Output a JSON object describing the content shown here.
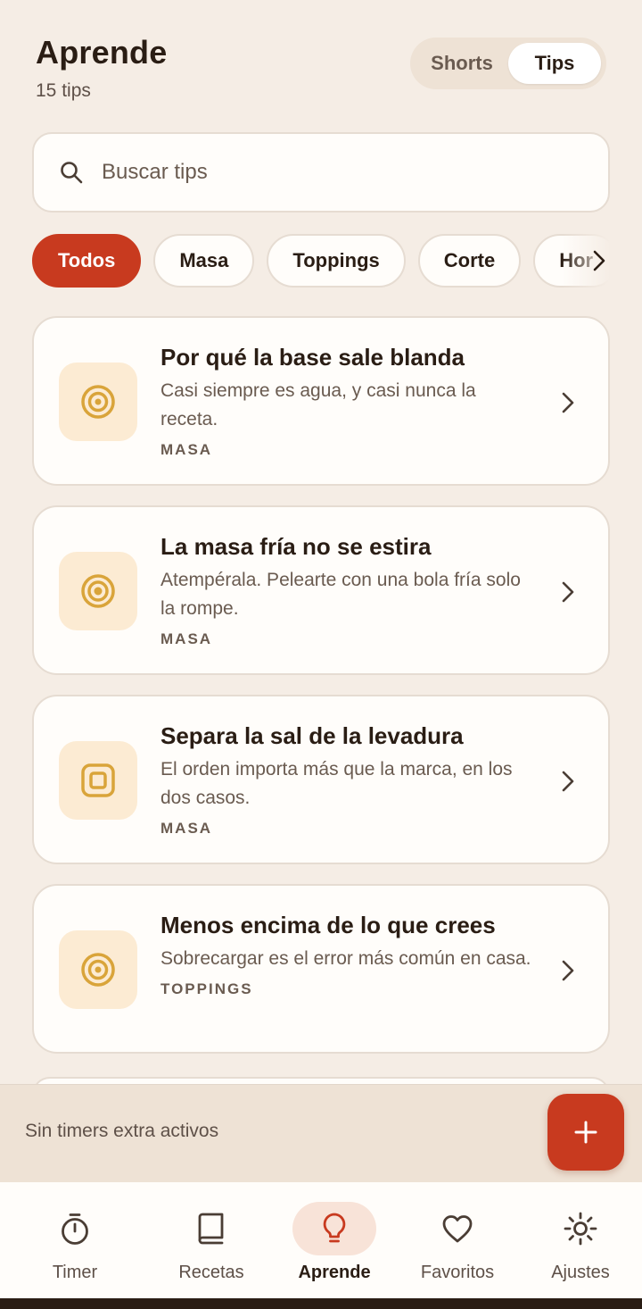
{
  "header": {
    "title": "Aprende",
    "subtitle": "15 tips"
  },
  "segmented": {
    "options": [
      "Shorts",
      "Tips"
    ],
    "selected": "Tips"
  },
  "search": {
    "placeholder": "Buscar tips",
    "value": ""
  },
  "filters": [
    "Todos",
    "Masa",
    "Toppings",
    "Corte",
    "Hor"
  ],
  "active_filter": "Todos",
  "tips": [
    {
      "title": "Por qué la base sale blanda",
      "description": "Casi siempre es agua, y casi nunca la receta.",
      "category": "MASA",
      "icon": "target-icon"
    },
    {
      "title": "La masa fría no se estira",
      "description": "Atempérala. Pelearte con una bola fría solo la rompe.",
      "category": "MASA",
      "icon": "target-icon"
    },
    {
      "title": "Separa la sal de la levadura",
      "description": "El orden importa más que la marca, en los dos casos.",
      "category": "MASA",
      "icon": "square-icon"
    },
    {
      "title": "Menos encima de lo que crees",
      "description": "Sobrecargar es el error más común en casa.",
      "category": "TOPPINGS",
      "icon": "target-icon"
    }
  ],
  "timer_bar": {
    "status": "Sin timers extra activos"
  },
  "nav": [
    {
      "label": "Timer",
      "icon": "stopwatch-icon"
    },
    {
      "label": "Recetas",
      "icon": "book-icon"
    },
    {
      "label": "Aprende",
      "icon": "lightbulb-icon",
      "active": true
    },
    {
      "label": "Favoritos",
      "icon": "heart-icon"
    },
    {
      "label": "Ajustes",
      "icon": "sun-gear-icon"
    }
  ],
  "colors": {
    "accent": "#C83A1F",
    "background": "#F5EDE5",
    "card": "#FFFDFA",
    "icon_gold": "#D9A43A"
  }
}
